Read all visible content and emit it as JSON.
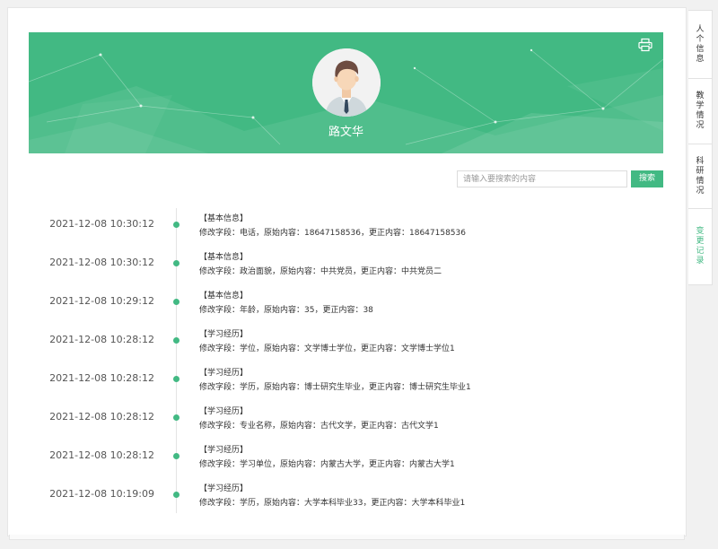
{
  "colors": {
    "accent": "#42b983"
  },
  "profile": {
    "name": "路文华",
    "print_icon": "printer-icon"
  },
  "search": {
    "placeholder": "请输入要搜索的内容",
    "value": "",
    "button_label": "搜索"
  },
  "tabs": [
    {
      "label": "人个信息",
      "active": false
    },
    {
      "label": "教学情况",
      "active": false
    },
    {
      "label": "科研情况",
      "active": false
    },
    {
      "label": "变更记录",
      "active": true
    }
  ],
  "records": [
    {
      "time": "2021-12-08 10:30:12",
      "category": "【基本信息】",
      "detail": "修改字段：电话，原始内容：18647158536，更正内容：18647158536"
    },
    {
      "time": "2021-12-08 10:30:12",
      "category": "【基本信息】",
      "detail": "修改字段：政治面貌，原始内容：中共党员，更正内容：中共党员二"
    },
    {
      "time": "2021-12-08 10:29:12",
      "category": "【基本信息】",
      "detail": "修改字段：年龄，原始内容：35，更正内容：38"
    },
    {
      "time": "2021-12-08 10:28:12",
      "category": "【学习经历】",
      "detail": "修改字段：学位，原始内容：文学博士学位，更正内容：文学博士学位1"
    },
    {
      "time": "2021-12-08 10:28:12",
      "category": "【学习经历】",
      "detail": "修改字段：学历，原始内容：博士研究生毕业，更正内容：博士研究生毕业1"
    },
    {
      "time": "2021-12-08 10:28:12",
      "category": "【学习经历】",
      "detail": "修改字段：专业名称，原始内容：古代文学，更正内容：古代文学1"
    },
    {
      "time": "2021-12-08 10:28:12",
      "category": "【学习经历】",
      "detail": "修改字段：学习单位，原始内容：内蒙古大学，更正内容：内蒙古大学1"
    },
    {
      "time": "2021-12-08 10:19:09",
      "category": "【学习经历】",
      "detail": "修改字段：学历，原始内容：大学本科毕业33，更正内容：大学本科毕业1"
    }
  ]
}
